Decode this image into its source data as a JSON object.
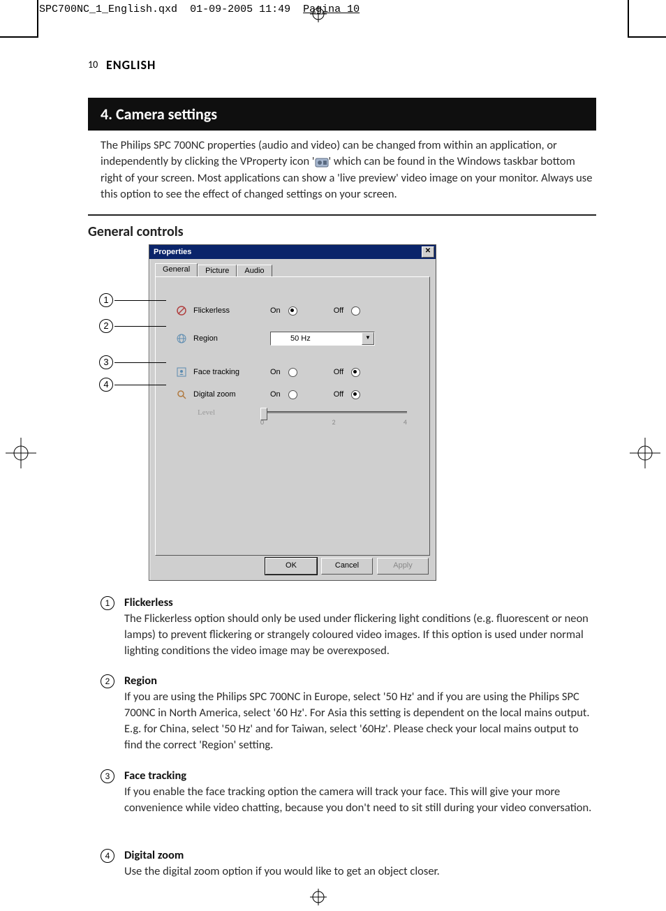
{
  "header": {
    "filename": "SPC700NC_1_English.qxd",
    "timestamp": "01-09-2005 11:49",
    "pagina": "Pagina 10"
  },
  "page_number": "10",
  "language": "ENGLISH",
  "chapter_title": "4. Camera settings",
  "intro_text_before_icon": "The Philips SPC 700NC properties (audio and video) can be changed from within an application, or independently by clicking the VProperty icon '",
  "intro_text_after_icon": "' which can be found in the Windows taskbar bottom right of your screen. Most applications can show a 'live preview' video image on your monitor. Always use this option to see the effect of changed settings on your screen.",
  "subheading": "General controls",
  "dialog": {
    "title": "Properties",
    "tabs": [
      "General",
      "Picture",
      "Audio"
    ],
    "active_tab": "General",
    "flickerless": {
      "label": "Flickerless",
      "on_label": "On",
      "off_label": "Off",
      "value": "On"
    },
    "region": {
      "label": "Region",
      "selected": "50 Hz"
    },
    "face_tracking": {
      "label": "Face tracking",
      "on_label": "On",
      "off_label": "Off",
      "value": "Off"
    },
    "digital_zoom": {
      "label": "Digital zoom",
      "on_label": "On",
      "off_label": "Off",
      "value": "Off"
    },
    "level": {
      "label": "Level",
      "ticks": [
        "0",
        "2",
        "4"
      ]
    },
    "buttons": {
      "ok": "OK",
      "cancel": "Cancel",
      "apply": "Apply"
    }
  },
  "callouts": [
    "1",
    "2",
    "3",
    "4"
  ],
  "descriptions": [
    {
      "n": "1",
      "title": "Flickerless",
      "body": "The Flickerless option should only be used under flickering light conditions (e.g. fluorescent or neon lamps) to prevent flickering or strangely coloured video images. If this option is used under normal lighting conditions the video image may be overexposed."
    },
    {
      "n": "2",
      "title": "Region",
      "body": "If you are using the Philips SPC 700NC in Europe, select '50 Hz' and if you are using the Philips SPC 700NC in North America, select '60 Hz'. For Asia this setting is dependent on the local mains output. E.g. for China, select '50 Hz' and for Taiwan, select '60Hz'. Please check your local mains output to find the correct 'Region' setting."
    },
    {
      "n": "3",
      "title": "Face tracking",
      "body": "If you enable the face tracking option the camera will track your face. This will give your more convenience while video chatting, because you don't need to sit still during your video conversation."
    },
    {
      "n": "4",
      "title": "Digital zoom",
      "body": "Use the digital zoom option if you would like to get an object closer."
    }
  ]
}
